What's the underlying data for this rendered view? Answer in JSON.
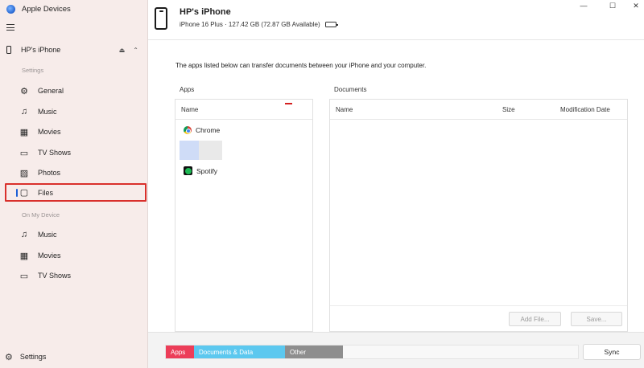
{
  "app": {
    "title": "Apple Devices"
  },
  "window": {
    "minimize": "—",
    "maximize": "☐",
    "close": "✕"
  },
  "sidebar": {
    "device_name": "HP's iPhone",
    "eject_glyph": "⏏",
    "collapse_glyph": "⌃",
    "settings_section": "Settings",
    "settings_items": [
      {
        "label": "General",
        "icon": "gear-icon",
        "glyph": "⚙"
      },
      {
        "label": "Music",
        "icon": "music-note-icon",
        "glyph": "♫"
      },
      {
        "label": "Movies",
        "icon": "film-icon",
        "glyph": "▦"
      },
      {
        "label": "TV Shows",
        "icon": "tv-icon",
        "glyph": "▭"
      },
      {
        "label": "Photos",
        "icon": "photo-icon",
        "glyph": "▨"
      },
      {
        "label": "Files",
        "icon": "folder-icon",
        "glyph": "▢",
        "active": true
      }
    ],
    "device_section": "On My Device",
    "device_items": [
      {
        "label": "Music",
        "icon": "music-note-icon",
        "glyph": "♫"
      },
      {
        "label": "Movies",
        "icon": "film-icon",
        "glyph": "▦"
      },
      {
        "label": "TV Shows",
        "icon": "tv-icon",
        "glyph": "▭"
      }
    ],
    "footer_settings": "Settings",
    "footer_glyph": "⚙"
  },
  "header": {
    "title": "HP's iPhone",
    "info": "iPhone 16 Plus · 127.42 GB (72.87 GB Available)",
    "battery_level": 0.45,
    "battery_color": "#4caf50"
  },
  "main": {
    "intro": "The apps listed below can transfer documents between your iPhone and your computer.",
    "apps_label": "Apps",
    "apps_header": "Name",
    "apps": [
      {
        "name": "Chrome",
        "icon": "chrome-icon"
      },
      {
        "name": "Spotify",
        "icon": "spotify-icon"
      }
    ],
    "documents_label": "Documents",
    "documents_columns": {
      "name": "Name",
      "size": "Size",
      "date": "Modification Date"
    },
    "add_file_button": "Add File...",
    "save_button": "Save..."
  },
  "storage": {
    "apps": "Apps",
    "documents": "Documents & Data",
    "other": "Other",
    "colors": {
      "apps": "#ec3d58",
      "documents": "#5cc8ef",
      "other": "#8e8e8e"
    }
  },
  "sync_button": "Sync"
}
